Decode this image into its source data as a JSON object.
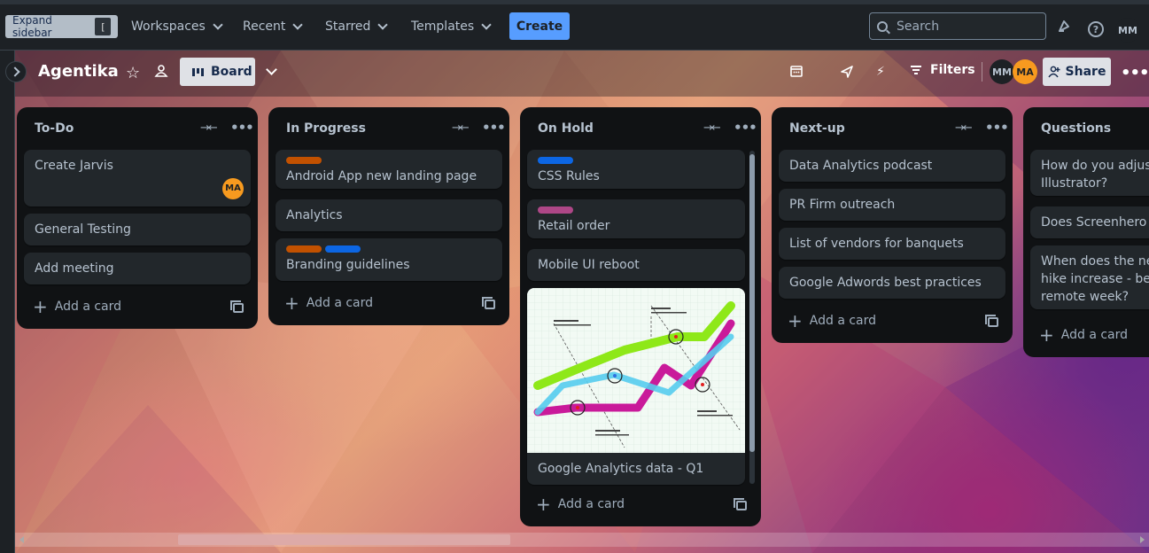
{
  "topnav": {
    "expand_sidebar_label": "Expand sidebar",
    "expand_shortcut": "[",
    "menus": [
      "Workspaces",
      "Recent",
      "Starred",
      "Templates"
    ],
    "create_label": "Create",
    "search_placeholder": "Search",
    "user_initials": "MM"
  },
  "board": {
    "title": "Agentika",
    "view_label": "Board",
    "filters_label": "Filters",
    "members": [
      {
        "initials": "MM",
        "color": "#1d2125"
      },
      {
        "initials": "MA",
        "color": "#f79a1f"
      }
    ],
    "share_label": "Share"
  },
  "labels": {
    "orange": "#c25100",
    "blue": "#0c66e4",
    "magenta": "#ae4787"
  },
  "lists": [
    {
      "title": "To-Do",
      "cards": [
        {
          "title": "Create Jarvis",
          "member": "MA"
        },
        {
          "title": "General Testing"
        },
        {
          "title": "Add meeting"
        }
      ],
      "add_card": "Add a card"
    },
    {
      "title": "In Progress",
      "cards": [
        {
          "title": "Android App new landing page",
          "labels": [
            "orange"
          ]
        },
        {
          "title": "Analytics"
        },
        {
          "title": "Branding guidelines",
          "labels": [
            "orange",
            "blue"
          ]
        }
      ],
      "add_card": "Add a card"
    },
    {
      "title": "On Hold",
      "cards": [
        {
          "title": "CSS Rules",
          "labels": [
            "blue"
          ]
        },
        {
          "title": "Retail order",
          "labels": [
            "magenta"
          ]
        },
        {
          "title": "Mobile UI reboot"
        },
        {
          "title": "Google Analytics data - Q1",
          "cover": "line-chart-infographic"
        }
      ],
      "add_card": "Add a card"
    },
    {
      "title": "Next-up",
      "cards": [
        {
          "title": "Data Analytics podcast"
        },
        {
          "title": "PR Firm outreach"
        },
        {
          "title": "List of vendors for banquets"
        },
        {
          "title": "Google Adwords best practices"
        }
      ],
      "add_card": "Add a card"
    },
    {
      "title": "Questions",
      "cards": [
        {
          "title": "How do you adjust t Illustrator?"
        },
        {
          "title": "Does Screenhero ha"
        },
        {
          "title": "When does the new hike increase - befo remote week?"
        }
      ],
      "add_card": "Add a card"
    }
  ]
}
